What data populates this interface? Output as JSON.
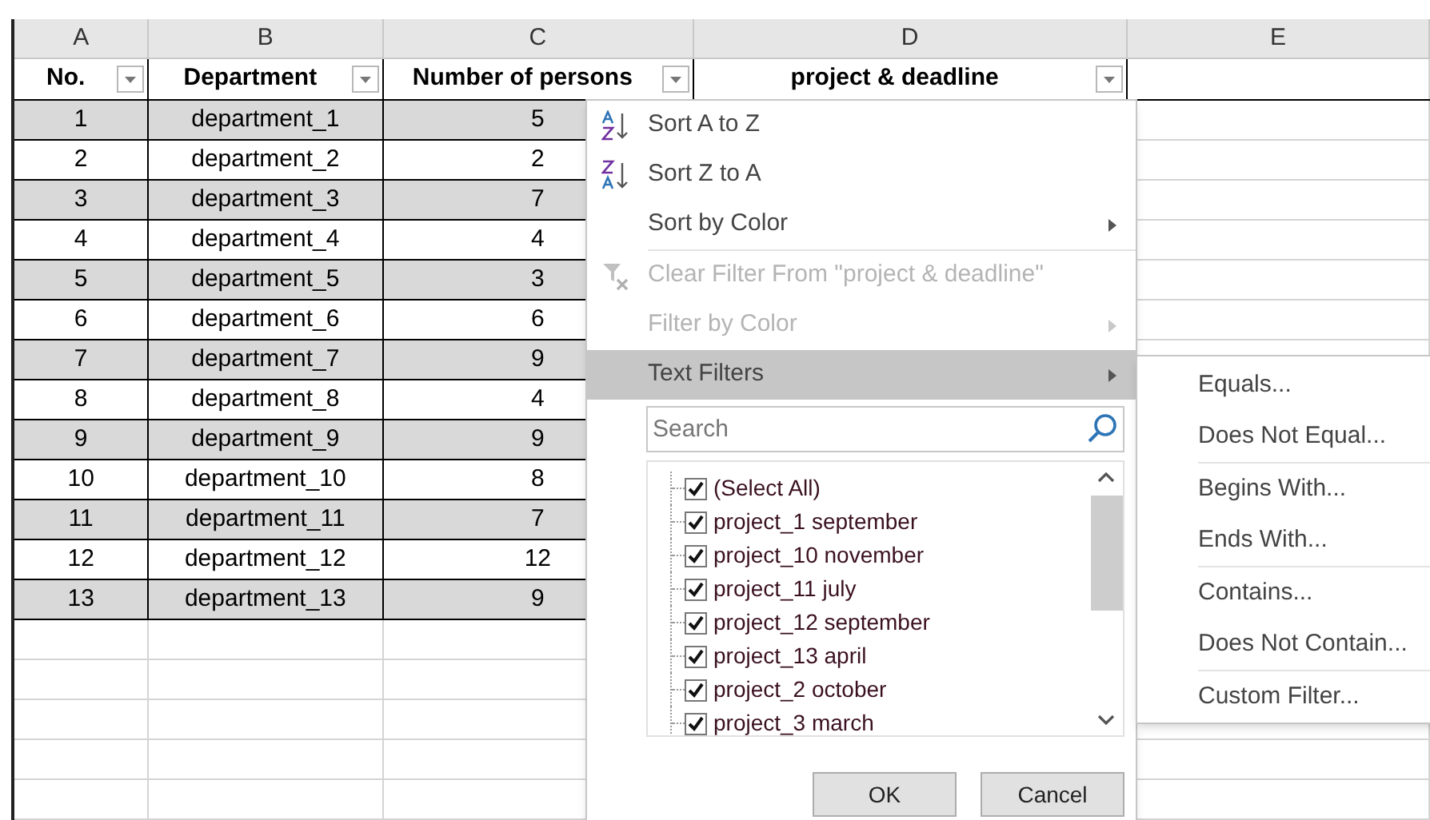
{
  "columns": [
    "A",
    "B",
    "C",
    "D",
    "E"
  ],
  "table": {
    "headers": [
      {
        "label": "No.",
        "filter": true
      },
      {
        "label": "Department",
        "filter": true
      },
      {
        "label": "Number of persons",
        "filter": true
      },
      {
        "label": "project & deadline",
        "filter": true
      }
    ],
    "rows": [
      [
        "1",
        "department_1",
        "5"
      ],
      [
        "2",
        "department_2",
        "2"
      ],
      [
        "3",
        "department_3",
        "7"
      ],
      [
        "4",
        "department_4",
        "4"
      ],
      [
        "5",
        "department_5",
        "3"
      ],
      [
        "6",
        "department_6",
        "6"
      ],
      [
        "7",
        "department_7",
        "9"
      ],
      [
        "8",
        "department_8",
        "4"
      ],
      [
        "9",
        "department_9",
        "9"
      ],
      [
        "10",
        "department_10",
        "8"
      ],
      [
        "11",
        "department_11",
        "7"
      ],
      [
        "12",
        "department_12",
        "12"
      ],
      [
        "13",
        "department_13",
        "9"
      ]
    ]
  },
  "filter_menu": {
    "groups": [
      [
        {
          "label": "Sort A to Z",
          "kind": "sort-asc",
          "disabled": false,
          "submenu": false,
          "selected": false
        },
        {
          "label": "Sort Z to A",
          "kind": "sort-desc",
          "disabled": false,
          "submenu": false,
          "selected": false
        },
        {
          "label": "Sort by Color",
          "kind": "plain",
          "disabled": false,
          "submenu": true,
          "selected": false
        }
      ],
      [
        {
          "label": "Clear Filter From \"project & deadline\"",
          "kind": "clear-filter",
          "disabled": true,
          "submenu": false,
          "selected": false
        },
        {
          "label": "Filter by Color",
          "kind": "plain",
          "disabled": true,
          "submenu": true,
          "selected": false
        },
        {
          "label": "Text Filters",
          "kind": "plain",
          "disabled": false,
          "submenu": true,
          "selected": true
        }
      ]
    ],
    "search": {
      "placeholder": "Search"
    },
    "values": [
      {
        "label": "(Select All)",
        "checked": true
      },
      {
        "label": "project_1 september",
        "checked": true
      },
      {
        "label": "project_10 november",
        "checked": true
      },
      {
        "label": "project_11 july",
        "checked": true
      },
      {
        "label": "project_12 september",
        "checked": true
      },
      {
        "label": "project_13 april",
        "checked": true
      },
      {
        "label": "project_2 october",
        "checked": true
      },
      {
        "label": "project_3 march",
        "checked": true
      }
    ],
    "buttons": [
      "OK",
      "Cancel"
    ]
  },
  "text_filters_menu": {
    "groups": [
      [
        "Equals...",
        "Does Not Equal..."
      ],
      [
        "Begins With...",
        "Ends With..."
      ],
      [
        "Contains...",
        "Does Not Contain..."
      ],
      [
        "Custom Filter..."
      ]
    ]
  }
}
